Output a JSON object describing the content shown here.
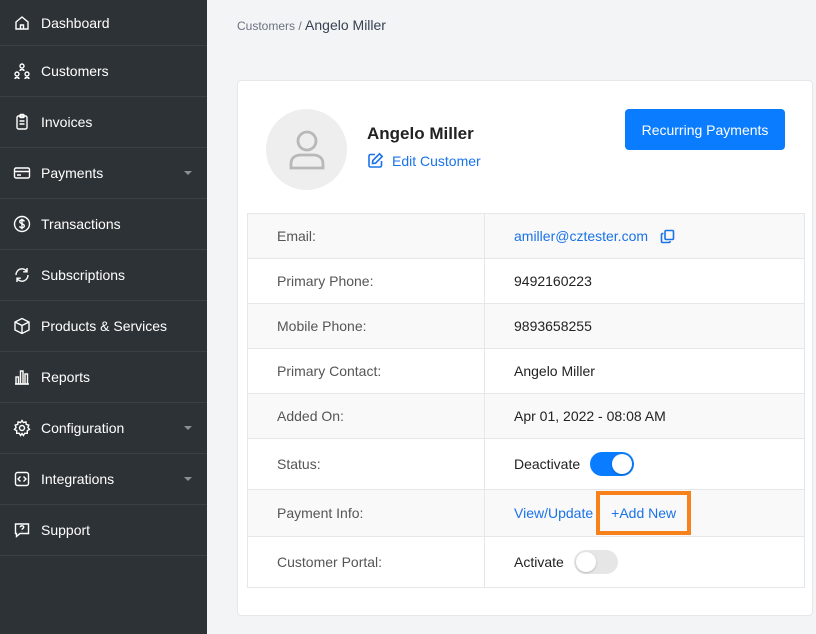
{
  "sidebar": {
    "items": [
      {
        "label": "Dashboard",
        "icon": "home-icon"
      },
      {
        "label": "Customers",
        "icon": "customers-icon"
      },
      {
        "label": "Invoices",
        "icon": "invoice-icon"
      },
      {
        "label": "Payments",
        "icon": "card-icon",
        "has_submenu": true
      },
      {
        "label": "Transactions",
        "icon": "dollar-icon"
      },
      {
        "label": "Subscriptions",
        "icon": "refresh-icon"
      },
      {
        "label": "Products & Services",
        "icon": "box-icon"
      },
      {
        "label": "Reports",
        "icon": "bar-chart-icon"
      },
      {
        "label": "Configuration",
        "icon": "gear-icon",
        "has_submenu": true
      },
      {
        "label": "Integrations",
        "icon": "code-icon",
        "has_submenu": true
      },
      {
        "label": "Support",
        "icon": "chat-question-icon"
      }
    ]
  },
  "breadcrumb": {
    "parent": "Customers",
    "separator": "/",
    "current": "Angelo Miller"
  },
  "customer": {
    "name": "Angelo Miller",
    "edit_label": "Edit Customer",
    "recurring_button": "Recurring Payments"
  },
  "details": {
    "email_label": "Email:",
    "email_value": "amiller@cztester.com",
    "primary_phone_label": "Primary Phone:",
    "primary_phone_value": "9492160223",
    "mobile_phone_label": "Mobile Phone:",
    "mobile_phone_value": "9893658255",
    "primary_contact_label": "Primary Contact:",
    "primary_contact_value": "Angelo Miller",
    "added_on_label": "Added On:",
    "added_on_value": "Apr 01, 2022 - 08:08 AM",
    "status_label": "Status:",
    "status_action": "Deactivate",
    "status_toggle_on": true,
    "payment_info_label": "Payment Info:",
    "payment_view_update": "View/Update",
    "payment_add_new": "+Add New",
    "portal_label": "Customer Portal:",
    "portal_action": "Activate",
    "portal_toggle_on": false
  },
  "colors": {
    "sidebar_bg": "#2d3236",
    "accent": "#0a7cff",
    "link": "#1a73e8",
    "highlight": "#f7821b"
  }
}
